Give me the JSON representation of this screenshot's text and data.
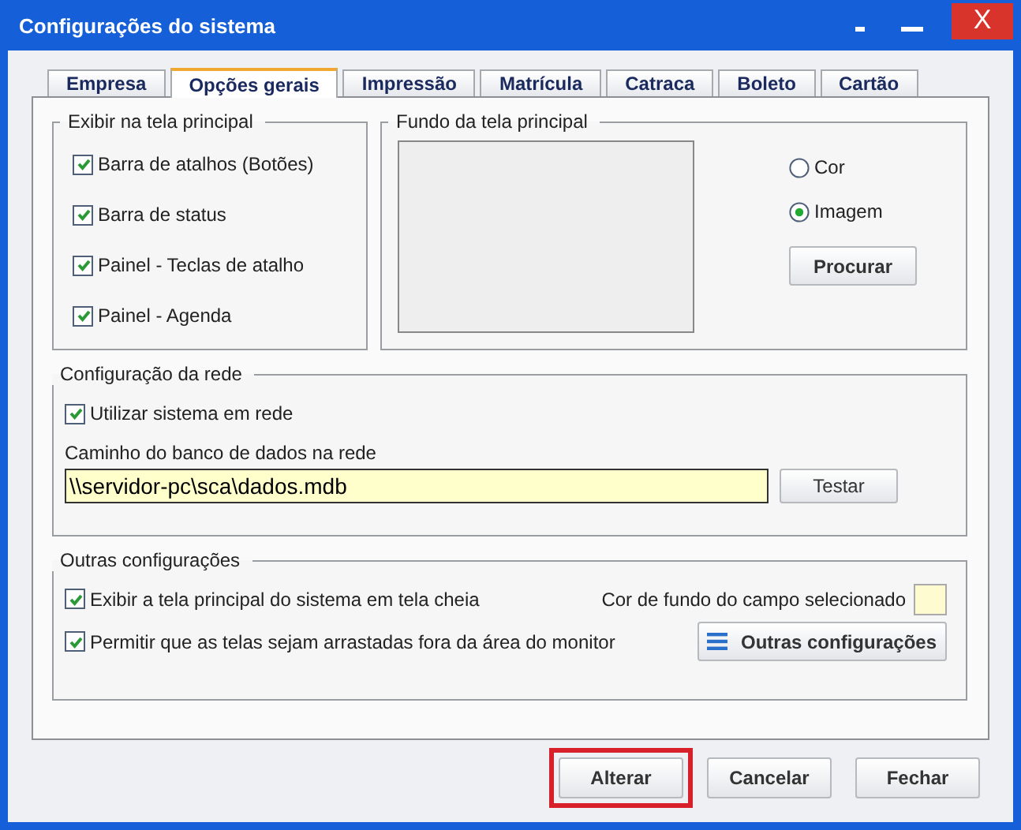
{
  "window": {
    "title": "Configurações do sistema",
    "close": "X"
  },
  "tabs": [
    {
      "label": "Empresa",
      "selected": false
    },
    {
      "label": "Opções gerais",
      "selected": true
    },
    {
      "label": "Impressão",
      "selected": false
    },
    {
      "label": "Matrícula",
      "selected": false
    },
    {
      "label": "Catraca",
      "selected": false
    },
    {
      "label": "Boleto",
      "selected": false
    },
    {
      "label": "Cartão",
      "selected": false
    }
  ],
  "display_group": {
    "title": "Exibir na tela principal",
    "checkboxes": [
      {
        "label": "Barra de atalhos (Botões)",
        "checked": true
      },
      {
        "label": "Barra de status",
        "checked": true
      },
      {
        "label": "Painel - Teclas de atalho",
        "checked": true
      },
      {
        "label": "Painel - Agenda",
        "checked": true
      }
    ]
  },
  "background_group": {
    "title": "Fundo da tela principal",
    "radios": [
      {
        "label": "Cor",
        "selected": false
      },
      {
        "label": "Imagem",
        "selected": true
      }
    ],
    "button": "Procurar"
  },
  "network_group": {
    "title": "Configuração da rede",
    "checkbox": {
      "label": "Utilizar sistema em rede",
      "checked": true
    },
    "path_label": "Caminho do banco de dados na rede",
    "path_value": "\\\\servidor-pc\\sca\\dados.mdb",
    "button": "Testar"
  },
  "other_group": {
    "title": "Outras configurações",
    "checkboxes": [
      {
        "label": "Exibir a tela principal do sistema em tela cheia",
        "checked": true
      },
      {
        "label": "Permitir que as telas sejam arrastadas fora da área do monitor",
        "checked": true
      }
    ],
    "color_label": "Cor de fundo do campo selecionado",
    "color": "#fffbd0",
    "button": "Outras configurações"
  },
  "buttons": [
    {
      "label": "Alterar",
      "highlighted": true
    },
    {
      "label": "Cancelar",
      "highlighted": false
    },
    {
      "label": "Fechar",
      "highlighted": false
    }
  ]
}
